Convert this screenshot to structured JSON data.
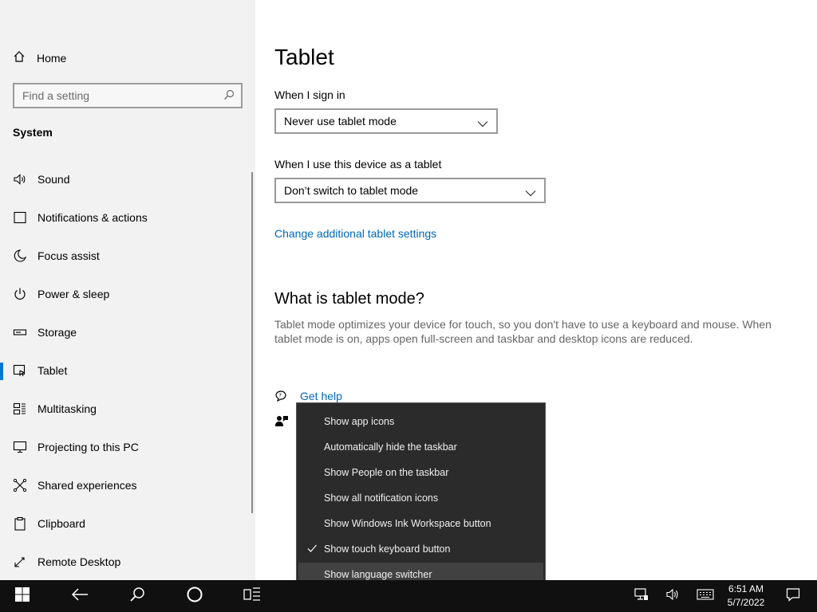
{
  "sidebar": {
    "home_label": "Home",
    "search_placeholder": "Find a setting",
    "section_title": "System",
    "items": [
      {
        "label": "Sound",
        "icon": "speaker-icon"
      },
      {
        "label": "Notifications & actions",
        "icon": "notification-icon"
      },
      {
        "label": "Focus assist",
        "icon": "moon-icon"
      },
      {
        "label": "Power & sleep",
        "icon": "power-icon"
      },
      {
        "label": "Storage",
        "icon": "storage-icon"
      },
      {
        "label": "Tablet",
        "icon": "tablet-icon",
        "active": true
      },
      {
        "label": "Multitasking",
        "icon": "multitasking-icon"
      },
      {
        "label": "Projecting to this PC",
        "icon": "projecting-icon"
      },
      {
        "label": "Shared experiences",
        "icon": "shared-experiences-icon"
      },
      {
        "label": "Clipboard",
        "icon": "clipboard-icon"
      },
      {
        "label": "Remote Desktop",
        "icon": "remote-desktop-icon"
      }
    ]
  },
  "main": {
    "title": "Tablet",
    "signin_label": "When I sign in",
    "signin_value": "Never use tablet mode",
    "device_label": "When I use this device as a tablet",
    "device_value": "Don’t switch to tablet mode",
    "change_link": "Change additional tablet settings",
    "what_heading": "What is tablet mode?",
    "what_desc": "Tablet mode optimizes your device for touch, so you don't have to use a keyboard and mouse. When tablet mode is on, apps open full-screen and taskbar and desktop icons are reduced.",
    "get_help": "Get help"
  },
  "context_menu": {
    "items": [
      {
        "label": "Show app icons",
        "checked": false
      },
      {
        "label": "Automatically hide the taskbar",
        "checked": false
      },
      {
        "label": "Show People on the taskbar",
        "checked": false
      },
      {
        "label": "Show all notification icons",
        "checked": false
      },
      {
        "label": "Show Windows Ink Workspace button",
        "checked": false
      },
      {
        "label": "Show touch keyboard button",
        "checked": true
      },
      {
        "label": "Show language switcher",
        "checked": false,
        "hovered": true
      }
    ]
  },
  "taskbar": {
    "time": "6:51 AM",
    "date": "5/7/2022"
  },
  "colors": {
    "accent": "#0078d7",
    "link": "#0067b8",
    "sidebar_bg": "#f2f2f2",
    "taskbar_bg": "#101010",
    "menu_bg": "#2b2b2b"
  }
}
